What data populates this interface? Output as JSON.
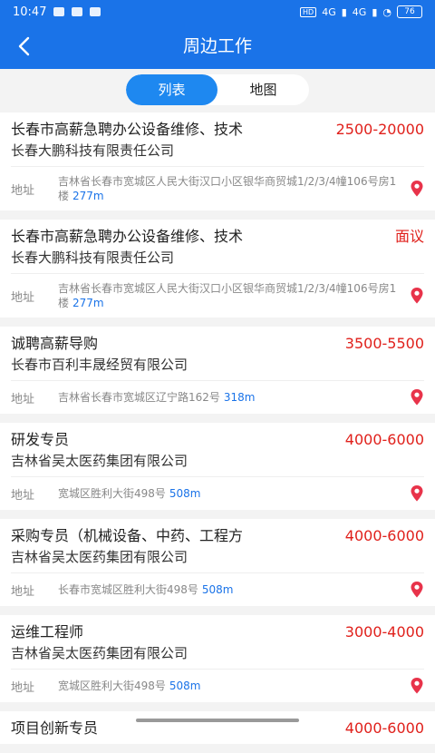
{
  "status": {
    "time": "10:47",
    "net1": "4G",
    "net2": "4G",
    "battery": "76"
  },
  "nav": {
    "title": "周边工作"
  },
  "tabs": {
    "list": "列表",
    "map": "地图"
  },
  "address_label": "地址",
  "jobs": [
    {
      "title": "长春市高薪急聘办公设备维修、技术",
      "salary": "2500-20000",
      "company": "长春大鹏科技有限责任公司",
      "address": "吉林省长春市宽城区人民大街汉口小区银华商贸城1/2/3/4幢106号房1楼",
      "distance": "277m"
    },
    {
      "title": "长春市高薪急聘办公设备维修、技术",
      "salary": "面议",
      "company": "长春大鹏科技有限责任公司",
      "address": "吉林省长春市宽城区人民大街汉口小区银华商贸城1/2/3/4幢106号房1楼",
      "distance": "277m"
    },
    {
      "title": "诚聘高薪导购",
      "salary": "3500-5500",
      "company": "长春市百利丰晟经贸有限公司",
      "address": "吉林省长春市宽城区辽宁路162号",
      "distance": "318m"
    },
    {
      "title": "研发专员",
      "salary": "4000-6000",
      "company": "吉林省吴太医药集团有限公司",
      "address": "宽城区胜利大街498号",
      "distance": "508m"
    },
    {
      "title": "采购专员（机械设备、中药、工程方",
      "salary": "4000-6000",
      "company": "吉林省吴太医药集团有限公司",
      "address": "长春市宽城区胜利大街498号",
      "distance": "508m"
    },
    {
      "title": "运维工程师",
      "salary": "3000-4000",
      "company": "吉林省吴太医药集团有限公司",
      "address": "宽城区胜利大街498号",
      "distance": "508m"
    },
    {
      "title": "项目创新专员",
      "salary": "4000-6000",
      "company": "",
      "address": "",
      "distance": ""
    }
  ],
  "colors": {
    "primary": "#1a73e8",
    "salary": "#e0201b",
    "pin": "#e8334a"
  }
}
